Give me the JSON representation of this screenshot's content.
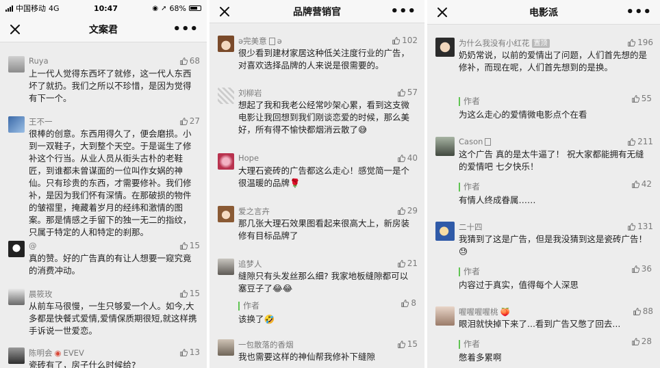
{
  "status_bar": {
    "carrier": "中国移动",
    "network": "4G",
    "time": "10:47",
    "battery": "68%",
    "battery_level": 0.68
  },
  "panels": [
    {
      "title": "文案君",
      "comments": [
        {
          "name": "Ruya",
          "likes": "68",
          "text": "上一代人觉得东西坏了就修，这一代人东西坏了就扔。我们之所以不珍惜，是因为觉得有下一个。"
        },
        {
          "name": "王不一",
          "likes": "27",
          "text": "很棒的创意。东西用得久了，便会磨损。小到一双鞋子，大到整个天空。于是诞生了修补这个行当。从业人员从街头古朴的老鞋匠，到谁都未曾谋面的一位叫作女娲的神仙。只有珍贵的东西，才需要修补。我们修补，是因为我们怀有深情。在那破损的物件的皱褶里，掩藏着岁月的经纬和激情的图案。那是情感之手留下的独一无二的指纹，只属于特定的人和特定的刹那。"
        },
        {
          "name": "@",
          "likes": "15",
          "text": "真的赞。好的广告真的有让人想要一窥究竟的消费冲动。"
        },
        {
          "name": "晨筱玫",
          "likes": "15",
          "text": "从前车马很慢，一生只够爱一个人。如今,大多都是快餐式爱情,爱情保质期很短,就这样携手诉说一世爱恋。"
        },
        {
          "name": "陈明会",
          "name_suffix": "EVEV",
          "likes": "13",
          "text": "瓷砖有了，房子什么时候给?"
        }
      ]
    },
    {
      "title": "品牌营销官",
      "comments": [
        {
          "name": "ә完美意",
          "name_suffix": "ә",
          "likes": "102",
          "text": "很少看到建材家居这种低关注度行业的广告，对喜欢选择品牌的人来说是很需要的。"
        },
        {
          "name": "刘柳岩",
          "likes": "57",
          "text": "想起了我和我老公经常吵架心累，看到这支微电影让我回想到我们刚谈恋爱的时候，那么美好，所有得不愉快都烟消云散了😅"
        },
        {
          "name": "Hope",
          "likes": "40",
          "text": "大理石瓷砖的广告都这么走心！感觉简一是个很温暖的品牌🌹"
        },
        {
          "name": "爱之言卉",
          "likes": "29",
          "text": "那几张大理石效果图看起来很高大上，新房装修有目标品牌了"
        },
        {
          "name": "追梦人",
          "likes": "21",
          "text": "缝隙只有头发丝那么细? 我家地板缝隙都可以塞豆子了😂😂",
          "reply": {
            "label": "作者",
            "text": "该换了🤣",
            "likes": "8"
          }
        },
        {
          "name": "一包散落的香烟",
          "likes": "15",
          "text": "我也需要这样的神仙帮我修补下缝隙"
        }
      ]
    },
    {
      "title": "电影派",
      "comments": [
        {
          "name": "为什么我没有小红花",
          "tag": "置顶",
          "likes": "196",
          "text": "奶奶常说，以前的爱情出了问题，人们首先想的是修补，而现在呢，人们首先想到的是换。",
          "reply": {
            "label": "作者",
            "text": "为这么走心的爱情微电影点个在看",
            "likes": "55"
          }
        },
        {
          "name": "Cason",
          "likes": "211",
          "text": "这个广告 真的是太牛逼了！ 祝大家都能拥有无缝的爱情吧 七夕快乐！",
          "reply": {
            "label": "作者",
            "text": "有情人终成眷属……",
            "likes": "42"
          }
        },
        {
          "name": "二十四",
          "likes": "131",
          "text": "我猜到了这是广告，但是我没猜到这是瓷砖广告！😓",
          "reply": {
            "label": "作者",
            "text": "内容过于真实，值得每个人深思",
            "likes": "36"
          }
        },
        {
          "name": "喔喔喔喔桃",
          "name_suffix": "🍑",
          "likes": "88",
          "text": "眼泪就快掉下来了...看到广告又憋了回去...",
          "reply": {
            "label": "作者",
            "text": "憋着多累啊",
            "likes": "28"
          }
        }
      ]
    }
  ],
  "icons": {
    "close": "close-icon",
    "more": "more-icon",
    "like": "thumb-up-icon"
  }
}
